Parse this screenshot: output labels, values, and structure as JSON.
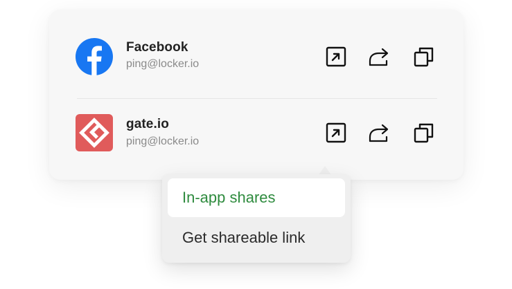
{
  "accounts": [
    {
      "name": "Facebook",
      "email": "ping@locker.io",
      "logo_icon": "facebook-logo-icon",
      "brand_color": "#1877f2"
    },
    {
      "name": "gate.io",
      "email": "ping@locker.io",
      "logo_icon": "gateio-logo-icon",
      "brand_color": "#e05b5b"
    }
  ],
  "actions": {
    "open_icon": "open-external-icon",
    "share_icon": "share-icon",
    "copy_icon": "copy-icon"
  },
  "share_menu": {
    "items": [
      {
        "label": "In-app shares",
        "active": true,
        "color": "#2e8b3e"
      },
      {
        "label": "Get shareable link",
        "active": false,
        "color": "#2a2a2a"
      }
    ]
  }
}
